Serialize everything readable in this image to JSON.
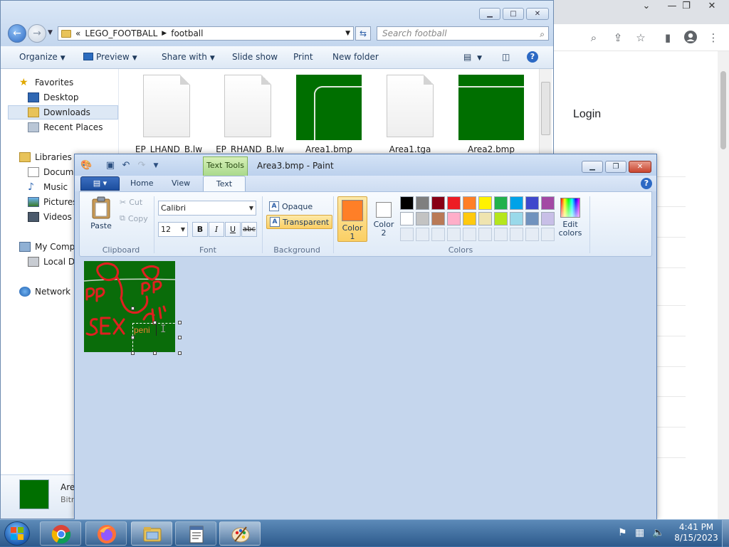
{
  "chrome": {
    "login_label": "Login"
  },
  "explorer": {
    "address": {
      "prefix": "«",
      "crumbs": [
        "LEGO_FOOTBALL",
        "football"
      ]
    },
    "search_placeholder": "Search football",
    "commands": {
      "organize": "Organize",
      "preview": "Preview",
      "share_with": "Share with",
      "slide_show": "Slide show",
      "print": "Print",
      "new_folder": "New folder"
    },
    "nav": {
      "favorites": "Favorites",
      "desktop": "Desktop",
      "downloads": "Downloads",
      "recent_places": "Recent Places",
      "libraries": "Libraries",
      "documents": "Docume",
      "music": "Music",
      "pictures": "Pictures",
      "videos": "Videos",
      "my_computer": "My Compu",
      "local_disk": "Local Dis",
      "network": "Network"
    },
    "files": [
      {
        "name": "_EP_LHAND_B.lw"
      },
      {
        "name": "_EP_RHAND_B.lw"
      },
      {
        "name": "Area1.bmp"
      },
      {
        "name": "Area1.tga"
      },
      {
        "name": "Area2.bmp"
      }
    ],
    "details": {
      "name": "Are",
      "type": "Bitr"
    }
  },
  "paint": {
    "title": "Area3.bmp - Paint",
    "context_tab": "Text Tools",
    "tabs": {
      "home": "Home",
      "view": "View",
      "text": "Text"
    },
    "clipboard": {
      "paste": "Paste",
      "cut": "Cut",
      "copy": "Copy",
      "label": "Clipboard"
    },
    "font": {
      "family": "Calibri",
      "size": "12",
      "bold": "B",
      "italic": "I",
      "underline": "U",
      "strike": "abc",
      "label": "Font"
    },
    "background": {
      "opaque": "Opaque",
      "transparent": "Transparent",
      "label": "Background"
    },
    "colors": {
      "color1_label": "Color\n1",
      "color2_label": "Color\n2",
      "color1_value": "#ff7f27",
      "color2_value": "#ffffff",
      "edit_label": "Edit\ncolors",
      "label": "Colors",
      "palette_row1": [
        "#000000",
        "#7f7f7f",
        "#880015",
        "#ed1c24",
        "#ff7f27",
        "#fff200",
        "#22b14c",
        "#00a2e8",
        "#3f48cc",
        "#a349a4"
      ],
      "palette_row2": [
        "#ffffff",
        "#c3c3c3",
        "#b97a57",
        "#ffaec9",
        "#ffc90e",
        "#efe4b0",
        "#b5e61d",
        "#99d9ea",
        "#7092be",
        "#c8bfe7"
      ]
    },
    "canvas": {
      "typed_text": "peni"
    }
  },
  "taskbar": {
    "time": "4:41 PM",
    "date": "8/15/2023"
  }
}
